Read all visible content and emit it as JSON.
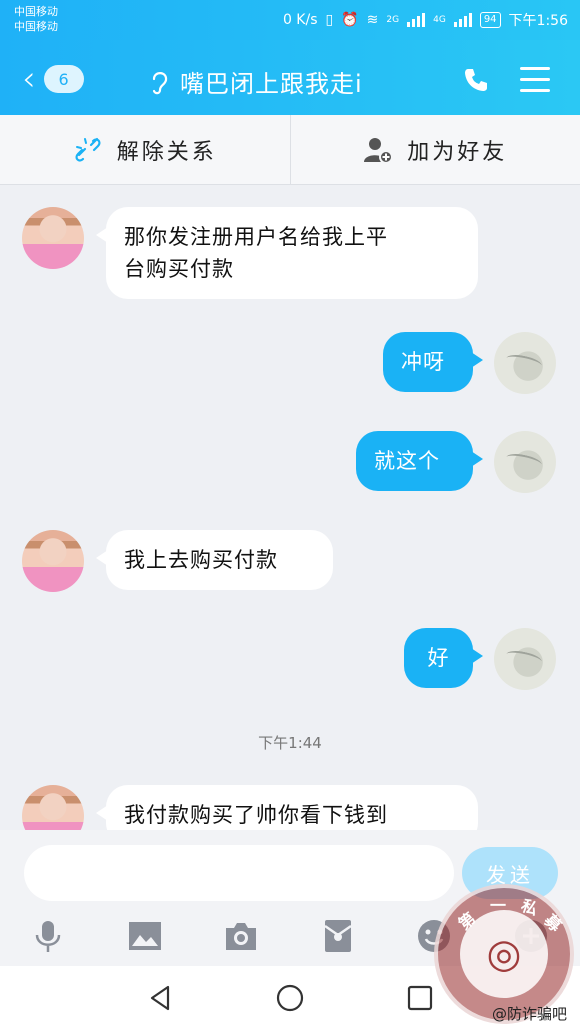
{
  "status_bar": {
    "carrier_1": "中国移动",
    "carrier_2": "中国移动",
    "speed": "0 K/s",
    "net_2g": "2G",
    "net_4g": "4G",
    "battery": "94",
    "time": "下午1:56"
  },
  "header": {
    "back_count": "6",
    "title": "嘴巴闭上跟我走i",
    "back_icon": "chevron-left-icon",
    "ear_icon": "ear-icon",
    "call_icon": "phone-icon",
    "menu_icon": "menu-icon"
  },
  "actions": {
    "unlink_label": "解除关系",
    "add_friend_label": "加为好友"
  },
  "messages": [
    {
      "side": "in",
      "lines": [
        "那你发注册用户名给我上平",
        "台购买付款"
      ]
    },
    {
      "side": "out",
      "text": "冲呀"
    },
    {
      "side": "out",
      "text": "就这个"
    },
    {
      "side": "in",
      "text": "我上去购买付款"
    },
    {
      "side": "out",
      "text": "好"
    },
    {
      "side": "in",
      "text": "我付款购买了帅你看下钱到"
    }
  ],
  "time_separator": "下午1:44",
  "input": {
    "placeholder": "",
    "send_label": "发送"
  },
  "toolbar": [
    "mic-icon",
    "image-icon",
    "camera-icon",
    "red-packet-icon",
    "emoji-icon",
    "plus-icon"
  ],
  "watermark": {
    "chars": [
      "第",
      "一",
      "私",
      "募"
    ],
    "credit": "@防诈骗吧"
  },
  "colors": {
    "accent": "#1fb1f7",
    "bubble_out": "#1ab2f5",
    "bubble_in": "#ffffff",
    "background": "#eef0f4"
  }
}
